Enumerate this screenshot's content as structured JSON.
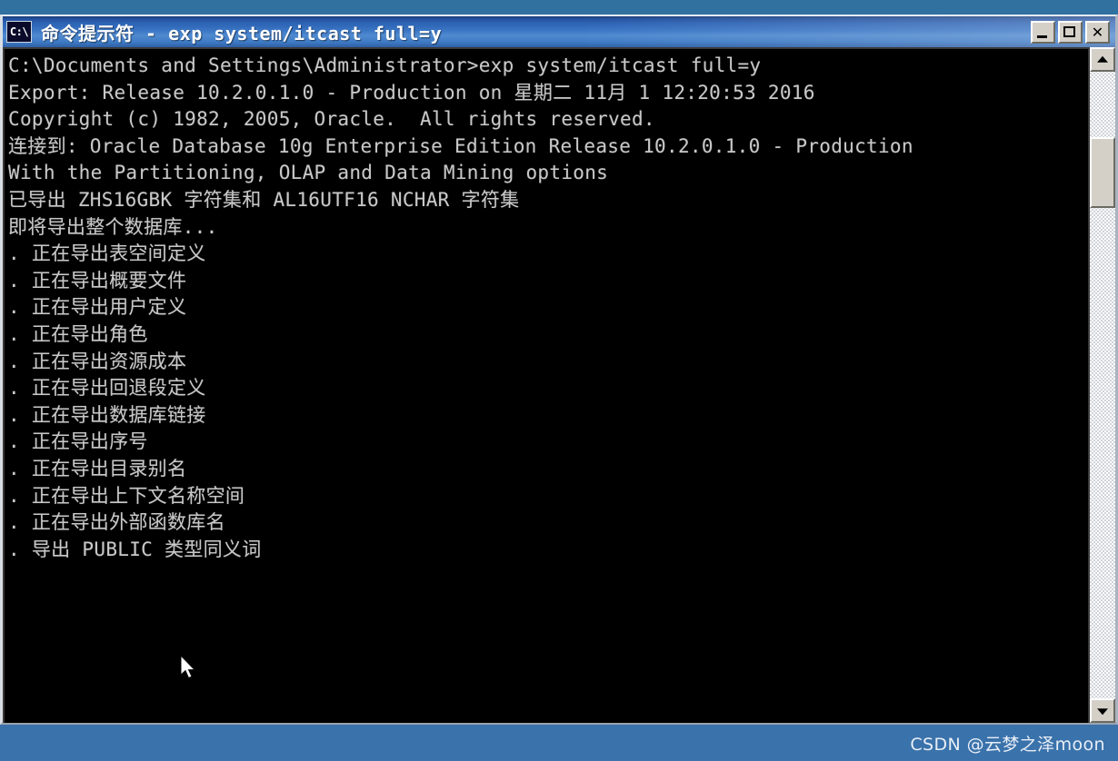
{
  "window": {
    "icon_name": "cmd-console-icon",
    "icon_label": "C:\\",
    "title": "命令提示符 - exp system/itcast full=y",
    "buttons": {
      "minimize": "minimize-button",
      "maximize": "maximize-button",
      "close": "✕"
    }
  },
  "console": {
    "lines": [
      "C:\\Documents and Settings\\Administrator>exp system/itcast full=y",
      "",
      "Export: Release 10.2.0.1.0 - Production on 星期二 11月 1 12:20:53 2016",
      "",
      "Copyright (c) 1982, 2005, Oracle.  All rights reserved.",
      "",
      "",
      "连接到: Oracle Database 10g Enterprise Edition Release 10.2.0.1.0 - Production",
      "With the Partitioning, OLAP and Data Mining options",
      "已导出 ZHS16GBK 字符集和 AL16UTF16 NCHAR 字符集",
      "",
      "即将导出整个数据库...",
      ". 正在导出表空间定义",
      ". 正在导出概要文件",
      ". 正在导出用户定义",
      ". 正在导出角色",
      ". 正在导出资源成本",
      ". 正在导出回退段定义",
      ". 正在导出数据库链接",
      ". 正在导出序号",
      ". 正在导出目录别名",
      ". 正在导出上下文名称空间",
      ". 正在导出外部函数库名",
      ". 导出 PUBLIC 类型同义词"
    ],
    "text_color": "#c8c8c8",
    "background_color": "#000000"
  },
  "scrollbar": {
    "up_arrow": "scroll-up-button",
    "down_arrow": "scroll-down-button",
    "thumb": "scroll-thumb"
  },
  "watermark": {
    "text": "CSDN @云梦之泽moon",
    "background_color": "#3a72ab"
  }
}
